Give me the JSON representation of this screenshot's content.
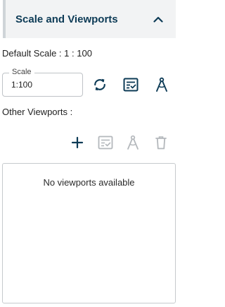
{
  "header": {
    "title": "Scale and Viewports",
    "chevron_icon": "chevron-up-icon"
  },
  "default_scale": {
    "label": "Default Scale :",
    "value": "1 : 100"
  },
  "scale_field": {
    "legend": "Scale",
    "value": "1:100"
  },
  "scale_actions": {
    "refresh_icon": "refresh-icon",
    "apply_icon": "checklist-icon",
    "measure_icon": "compass-icon"
  },
  "other_viewports": {
    "label": "Other Viewports :",
    "add_icon": "plus-icon",
    "apply_icon": "checklist-icon",
    "measure_icon": "compass-icon",
    "delete_icon": "trash-icon",
    "empty_message": "No viewports available"
  },
  "colors": {
    "accent": "#0d3b56",
    "disabled": "#b4b8bc",
    "header_bg": "#f2f3f4",
    "border": "#c6cacd"
  }
}
